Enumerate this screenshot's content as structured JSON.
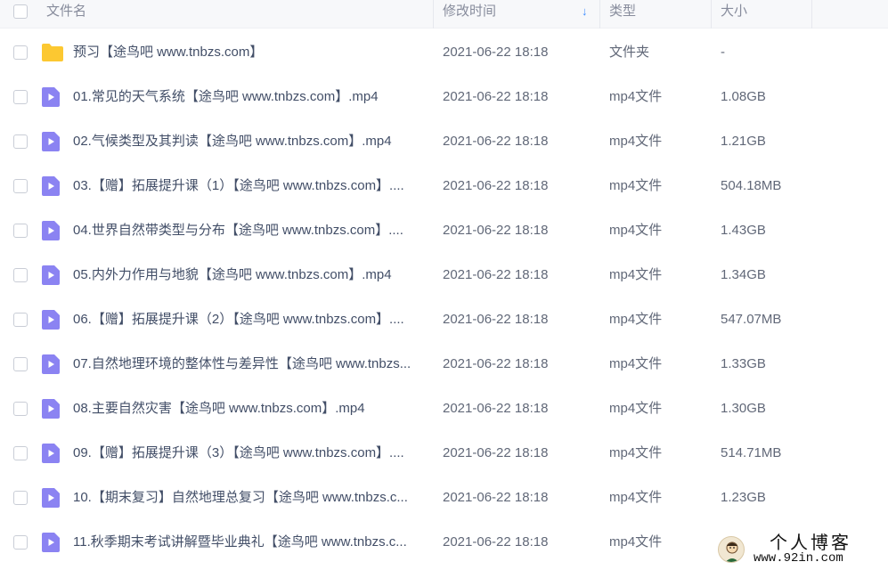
{
  "header": {
    "name": "文件名",
    "modified": "修改时间",
    "sort_arrow": "↓",
    "type": "类型",
    "size": "大小"
  },
  "files": [
    {
      "name": "预习【途鸟吧 www.tnbzs.com】",
      "date": "2021-06-22 18:18",
      "type": "文件夹",
      "size": "-",
      "icon": "folder"
    },
    {
      "name": "01.常见的天气系统【途鸟吧 www.tnbzs.com】.mp4",
      "date": "2021-06-22 18:18",
      "type": "mp4文件",
      "size": "1.08GB",
      "icon": "video"
    },
    {
      "name": "02.气候类型及其判读【途鸟吧 www.tnbzs.com】.mp4",
      "date": "2021-06-22 18:18",
      "type": "mp4文件",
      "size": "1.21GB",
      "icon": "video"
    },
    {
      "name": "03.【赠】拓展提升课（1）【途鸟吧 www.tnbzs.com】....",
      "date": "2021-06-22 18:18",
      "type": "mp4文件",
      "size": "504.18MB",
      "icon": "video"
    },
    {
      "name": "04.世界自然带类型与分布【途鸟吧 www.tnbzs.com】....",
      "date": "2021-06-22 18:18",
      "type": "mp4文件",
      "size": "1.43GB",
      "icon": "video"
    },
    {
      "name": "05.内外力作用与地貌【途鸟吧 www.tnbzs.com】.mp4",
      "date": "2021-06-22 18:18",
      "type": "mp4文件",
      "size": "1.34GB",
      "icon": "video"
    },
    {
      "name": "06.【赠】拓展提升课（2）【途鸟吧 www.tnbzs.com】....",
      "date": "2021-06-22 18:18",
      "type": "mp4文件",
      "size": "547.07MB",
      "icon": "video"
    },
    {
      "name": "07.自然地理环境的整体性与差异性【途鸟吧 www.tnbzs...",
      "date": "2021-06-22 18:18",
      "type": "mp4文件",
      "size": "1.33GB",
      "icon": "video"
    },
    {
      "name": "08.主要自然灾害【途鸟吧 www.tnbzs.com】.mp4",
      "date": "2021-06-22 18:18",
      "type": "mp4文件",
      "size": "1.30GB",
      "icon": "video"
    },
    {
      "name": "09.【赠】拓展提升课（3）【途鸟吧 www.tnbzs.com】....",
      "date": "2021-06-22 18:18",
      "type": "mp4文件",
      "size": "514.71MB",
      "icon": "video"
    },
    {
      "name": "10.【期末复习】自然地理总复习【途鸟吧 www.tnbzs.c...",
      "date": "2021-06-22 18:18",
      "type": "mp4文件",
      "size": "1.23GB",
      "icon": "video"
    },
    {
      "name": "11.秋季期末考试讲解暨毕业典礼【途鸟吧 www.tnbzs.c...",
      "date": "2021-06-22 18:18",
      "type": "mp4文件",
      "size": "",
      "icon": "video"
    }
  ],
  "watermark": {
    "title": "个人博客",
    "url": "www.92in.com"
  },
  "colors": {
    "folder": "#fcc831",
    "video": "#8b83f2",
    "accent": "#3b8cff"
  }
}
